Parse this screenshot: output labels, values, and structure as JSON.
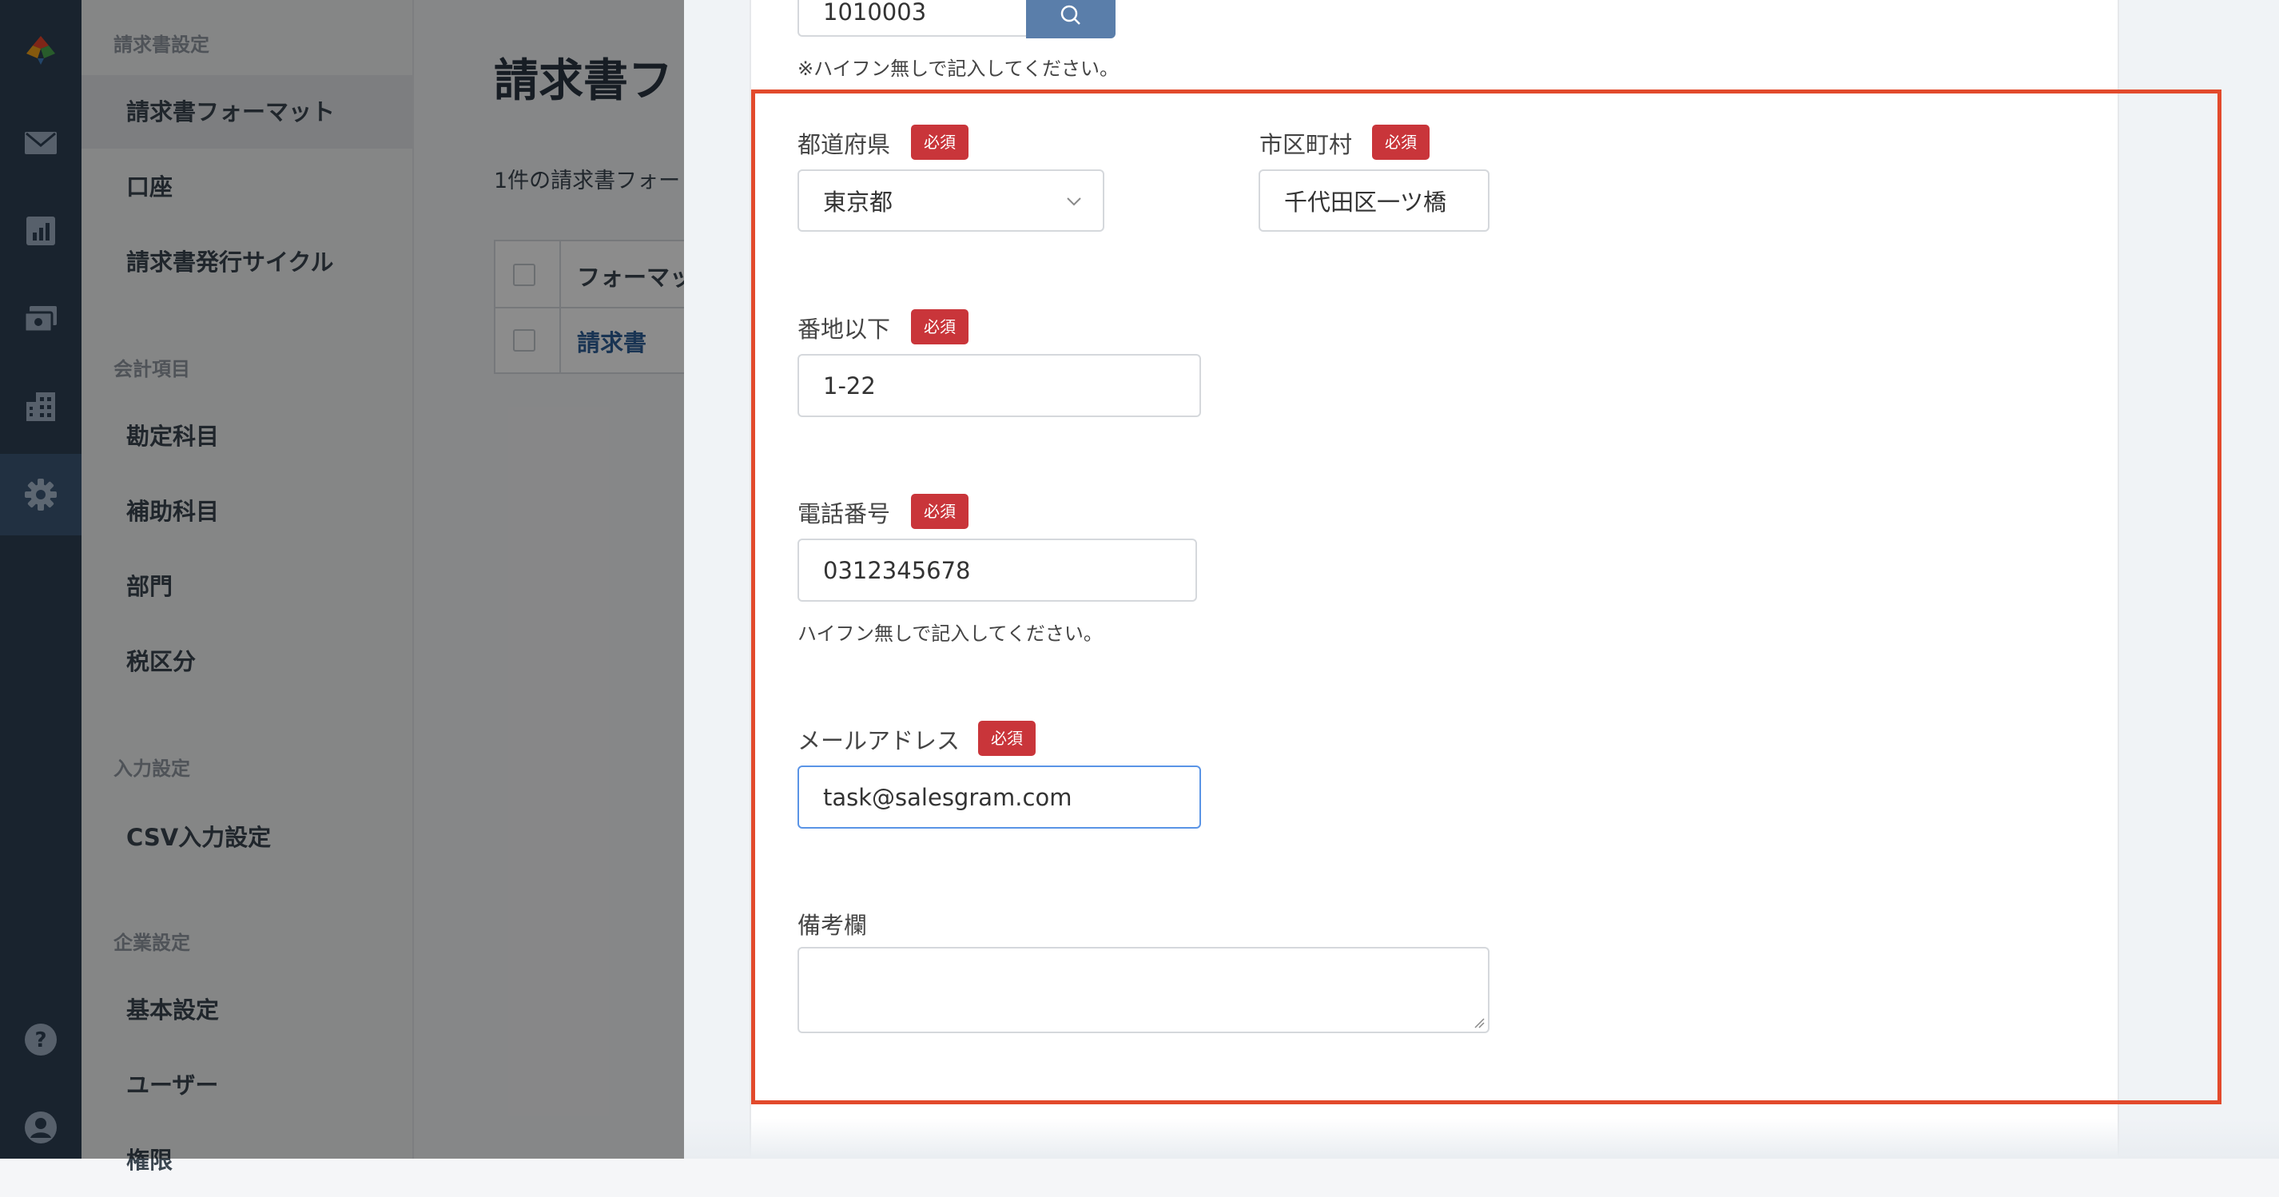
{
  "sidebar": {
    "sections": [
      {
        "title": "請求書設定",
        "items": [
          "請求書フォーマット",
          "口座",
          "請求書発行サイクル"
        ]
      },
      {
        "title": "会計項目",
        "items": [
          "勘定科目",
          "補助科目",
          "部門",
          "税区分"
        ]
      },
      {
        "title": "入力設定",
        "items": [
          "CSV入力設定"
        ]
      },
      {
        "title": "企業設定",
        "items": [
          "基本設定",
          "ユーザー",
          "権限"
        ]
      }
    ]
  },
  "rail": {
    "icons": [
      "logo-icon",
      "mail-icon",
      "chart-icon",
      "payment-icon",
      "building-icon",
      "settings-icon",
      "help-icon",
      "user-icon"
    ]
  },
  "main": {
    "title": "請求書フ",
    "count_text": "1件の請求書フォー",
    "table": {
      "header": "フォーマッ",
      "row": "請求書"
    }
  },
  "form": {
    "zip_value": "1010003",
    "zip_hint": "※ハイフン無しで記入してください。",
    "required_badge": "必須",
    "prefecture": {
      "label": "都道府県",
      "value": "東京都"
    },
    "city": {
      "label": "市区町村",
      "value": "千代田区一ツ橋"
    },
    "address": {
      "label": "番地以下",
      "value": "1-22"
    },
    "phone": {
      "label": "電話番号",
      "value": "0312345678",
      "hint": "ハイフン無しで記入してください。"
    },
    "email": {
      "label": "メールアドレス",
      "value": "task@salesgram.com"
    },
    "remarks": {
      "label": "備考欄",
      "value": ""
    }
  },
  "colors": {
    "rail": "#2f4055",
    "badge": "#c9353a",
    "highlight": "#e24a2c",
    "focus": "#5a94e6",
    "search_button": "#5a7eaa"
  }
}
